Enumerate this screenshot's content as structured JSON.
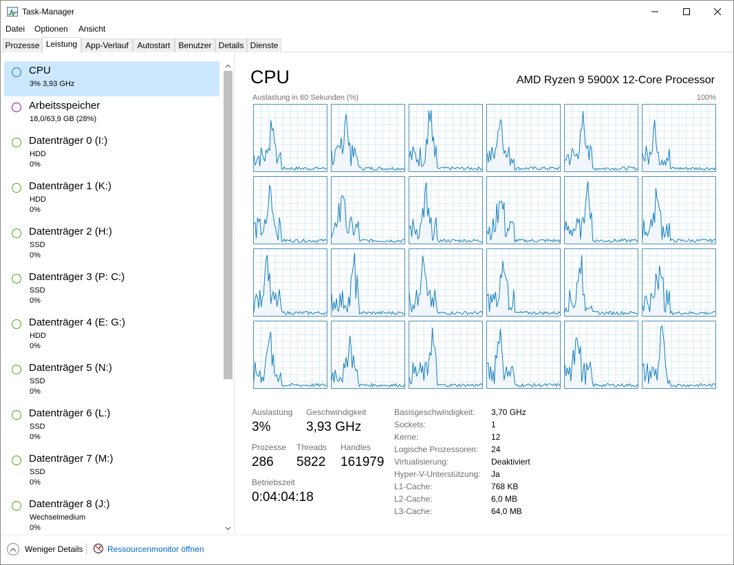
{
  "window": {
    "title": "Task-Manager"
  },
  "menu": [
    "Datei",
    "Optionen",
    "Ansicht"
  ],
  "tabs": [
    "Prozesse",
    "Leistung",
    "App-Verlauf",
    "Autostart",
    "Benutzer",
    "Details",
    "Dienste"
  ],
  "active_tab": "Leistung",
  "sidebar": [
    {
      "title": "CPU",
      "line1": "3%  3,93 GHz",
      "line2": "",
      "color": "#117dbb"
    },
    {
      "title": "Arbeitsspeicher",
      "line1": "18,0/63,9 GB (28%)",
      "line2": "",
      "color": "#8b12ae"
    },
    {
      "title": "Datenträger 0 (I:)",
      "line1": "HDD",
      "line2": "0%",
      "color": "#4da60c"
    },
    {
      "title": "Datenträger 1 (K:)",
      "line1": "HDD",
      "line2": "0%",
      "color": "#4da60c"
    },
    {
      "title": "Datenträger 2 (H:)",
      "line1": "SSD",
      "line2": "0%",
      "color": "#4da60c"
    },
    {
      "title": "Datenträger 3 (P: C:)",
      "line1": "SSD",
      "line2": "0%",
      "color": "#4da60c"
    },
    {
      "title": "Datenträger 4 (E: G:)",
      "line1": "HDD",
      "line2": "0%",
      "color": "#4da60c"
    },
    {
      "title": "Datenträger 5 (N:)",
      "line1": "SSD",
      "line2": "0%",
      "color": "#4da60c"
    },
    {
      "title": "Datenträger 6 (L:)",
      "line1": "SSD",
      "line2": "0%",
      "color": "#4da60c"
    },
    {
      "title": "Datenträger 7 (M:)",
      "line1": "SSD",
      "line2": "0%",
      "color": "#4da60c"
    },
    {
      "title": "Datenträger 8 (J:)",
      "line1": "Wechselmedium",
      "line2": "0%",
      "color": "#4da60c"
    }
  ],
  "cpu": {
    "heading": "CPU",
    "model": "AMD Ryzen 9 5900X 12-Core Processor",
    "graph_label": "Auslastung in 60 Sekunden (%)",
    "graph_max": "100%",
    "graph_color": "#117dbb",
    "stats": {
      "util_label": "Auslastung",
      "util_value": "3%",
      "speed_label": "Geschwindigkeit",
      "speed_value": "3,93 GHz",
      "proc_label": "Prozesse",
      "proc_value": "286",
      "threads_label": "Threads",
      "threads_value": "5822",
      "handles_label": "Handles",
      "handles_value": "161979",
      "uptime_label": "Betriebszeit",
      "uptime_value": "0:04:04:18"
    },
    "specs": [
      {
        "label": "Basisgeschwindigkeit:",
        "value": "3,70 GHz"
      },
      {
        "label": "Sockets:",
        "value": "1"
      },
      {
        "label": "Kerne:",
        "value": "12"
      },
      {
        "label": "Logische Prozessoren:",
        "value": "24"
      },
      {
        "label": "Virtualisierung:",
        "value": "Deaktiviert"
      },
      {
        "label": "Hyper-V-Unterstützung:",
        "value": "Ja"
      },
      {
        "label": "L1-Cache:",
        "value": "768 KB"
      },
      {
        "label": "L2-Cache:",
        "value": "6,0 MB"
      },
      {
        "label": "L3-Cache:",
        "value": "64,0 MB"
      }
    ]
  },
  "footer": {
    "fewer_details": "Weniger Details",
    "resource_monitor": "Ressourcenmonitor öffnen"
  },
  "icons": {
    "app": "task-manager-icon",
    "minimize": "minimize-icon",
    "maximize": "maximize-icon",
    "close": "close-icon",
    "fewer": "chevron-up-icon",
    "resmon": "resource-monitor-icon"
  }
}
